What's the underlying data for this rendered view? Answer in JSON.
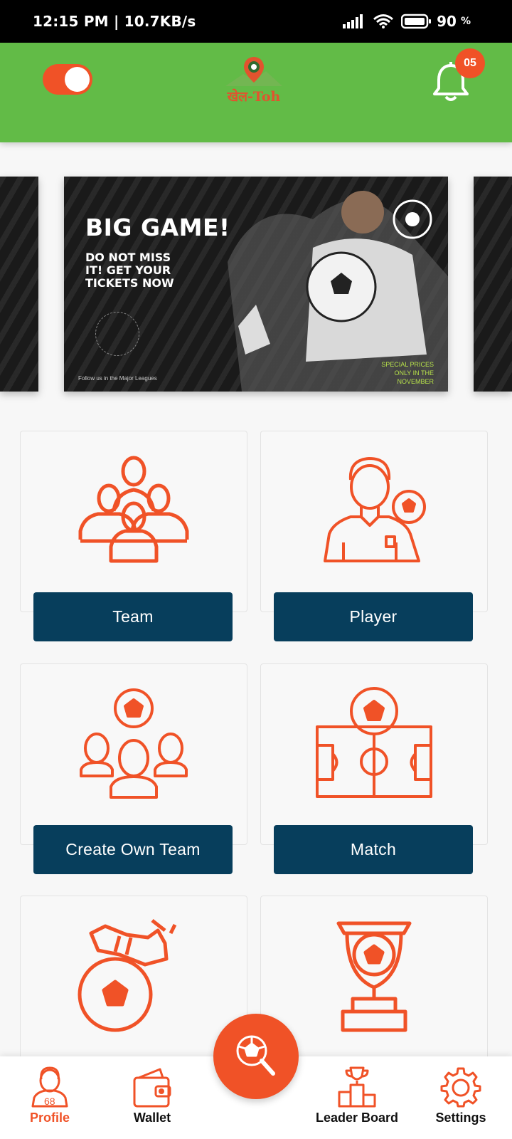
{
  "status_bar": {
    "time": "12:15 PM | 10.7KB/s",
    "battery_percent": "90",
    "battery_unit": "%"
  },
  "header": {
    "logo_text": "खेल-Toh",
    "notification_count": "05",
    "toggle_on": true
  },
  "banner": {
    "title": "BIG GAME!",
    "subtitle": "DO NOT MISS IT! GET YOUR TICKETS NOW",
    "footer": "Follow us in the Major Leagues",
    "promo": "SPECIAL PRICES ONLY IN THE NOVEMBER"
  },
  "cards": [
    {
      "label": "Team"
    },
    {
      "label": "Player"
    },
    {
      "label": "Create Own Team"
    },
    {
      "label": "Match"
    }
  ],
  "bottom_nav": {
    "items": [
      {
        "label": "Profile"
      },
      {
        "label": "Wallet"
      },
      {
        "label": "Leader Board"
      },
      {
        "label": "Settings"
      }
    ]
  },
  "colors": {
    "accent": "#f05227",
    "header": "#62bb47",
    "button": "#073e5c"
  }
}
